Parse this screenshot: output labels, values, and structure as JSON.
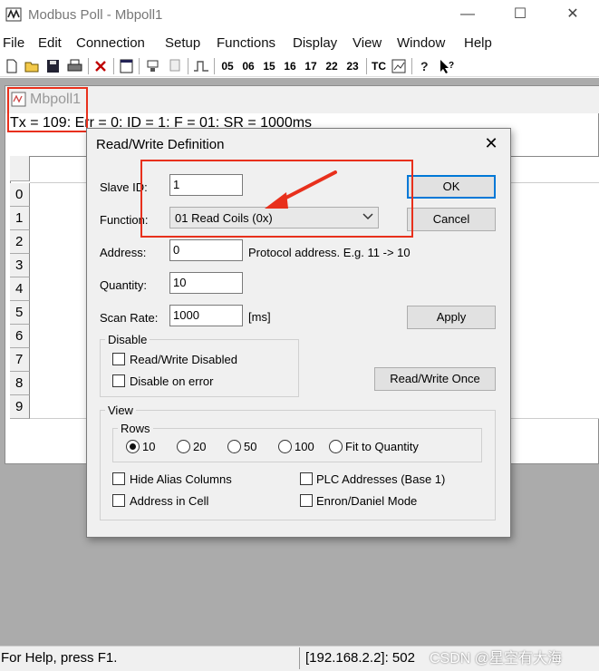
{
  "window": {
    "title": "Modbus Poll - Mbpoll1",
    "controls": {
      "minimize": "—",
      "maximize": "☐",
      "close": "✕"
    }
  },
  "menu": [
    "File",
    "Edit",
    "Connection",
    "Setup",
    "Functions",
    "Display",
    "View",
    "Window",
    "Help"
  ],
  "toolbar": {
    "function_codes": [
      "05",
      "06",
      "15",
      "16",
      "17",
      "22",
      "23"
    ],
    "tc_label": "TC",
    "icons": [
      "new-icon",
      "open-icon",
      "save-icon",
      "print-icon",
      "delete-icon",
      "window-icon",
      "connect-icon",
      "disconnect-icon",
      "pulse-icon",
      "chart-icon",
      "help-icon",
      "context-help-icon"
    ]
  },
  "child_window": {
    "title": "Mbpoll1",
    "status": "Tx = 109: Err = 0: ID = 1: F = 01: SR = 1000ms",
    "rows": [
      "0",
      "1",
      "2",
      "3",
      "4",
      "5",
      "6",
      "7",
      "8",
      "9"
    ]
  },
  "dialog": {
    "title": "Read/Write Definition",
    "close": "✕",
    "slave_id": {
      "label": "Slave ID:",
      "value": "1"
    },
    "function": {
      "label": "Function:",
      "value": "01 Read Coils (0x)"
    },
    "address": {
      "label": "Address:",
      "value": "0",
      "hint": "Protocol address. E.g. 11 -> 10"
    },
    "quantity": {
      "label": "Quantity:",
      "value": "10"
    },
    "scan_rate": {
      "label": "Scan Rate:",
      "value": "1000",
      "unit": "[ms]"
    },
    "buttons": {
      "ok": "OK",
      "cancel": "Cancel",
      "apply": "Apply",
      "read_write_once": "Read/Write Once"
    },
    "disable_group": {
      "label": "Disable",
      "read_write_disabled": {
        "label": "Read/Write Disabled",
        "checked": false
      },
      "disable_on_error": {
        "label": "Disable on error",
        "checked": false
      }
    },
    "view_group": {
      "label": "View",
      "rows_label": "Rows",
      "rows_options": [
        "10",
        "20",
        "50",
        "100",
        "Fit to Quantity"
      ],
      "rows_selected": "10",
      "hide_alias_columns": {
        "label": "Hide Alias Columns",
        "checked": false
      },
      "plc_addresses": {
        "label": "PLC Addresses (Base 1)",
        "checked": false
      },
      "address_in_cell": {
        "label": "Address in Cell",
        "checked": false
      },
      "enron_daniel_mode": {
        "label": "Enron/Daniel Mode",
        "checked": false
      }
    }
  },
  "statusbar": {
    "help": "For Help, press F1.",
    "connection": "[192.168.2.2]: 502",
    "watermark": "CSDN @星空有大海"
  },
  "colors": {
    "annotation": "#e8301c",
    "default_button_border": "#0078d7",
    "mdi_background": "#ababab"
  }
}
